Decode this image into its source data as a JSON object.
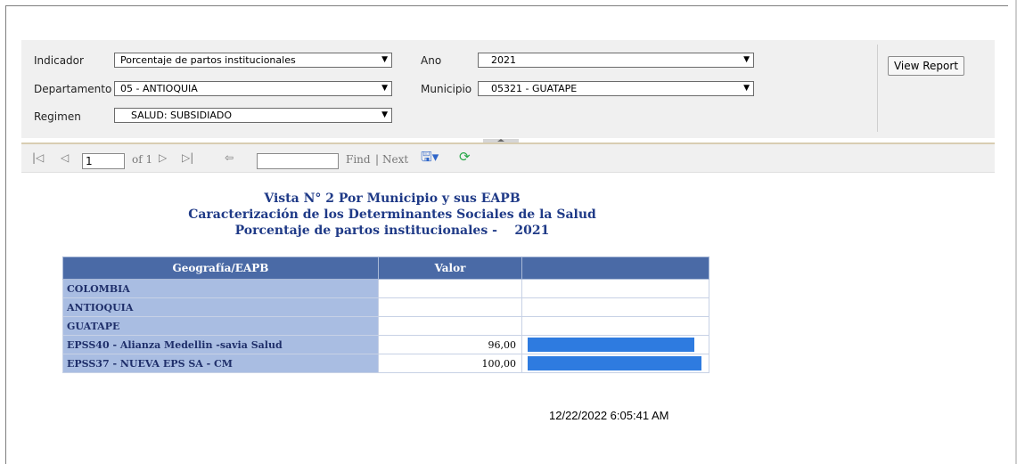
{
  "params": {
    "indicador_label": "Indicador",
    "indicador_value": "Porcentaje de partos institucionales",
    "departamento_label": "Departamento",
    "departamento_value": "05 - ANTIOQUIA",
    "regimen_label": "Regimen",
    "regimen_value": "SALUD: SUBSIDIADO",
    "ano_label": "Ano",
    "ano_value": "2021",
    "municipio_label": "Municipio",
    "municipio_value": "05321 - GUATAPE",
    "view_report_label": "View Report"
  },
  "toolbar": {
    "page_value": "1",
    "of_pages": "of 1",
    "find_label": "Find",
    "separator": "|",
    "next_label": "Next",
    "find_value": ""
  },
  "report": {
    "title_line1": "Vista N° 2 Por Municipio y sus EAPB",
    "title_line2": "Caracterización de los Determinantes Sociales de la Salud",
    "title_line3": "Porcentaje de partos institucionales -    2021",
    "col_geo": "Geografía/EAPB",
    "col_valor": "Valor",
    "rows": [
      {
        "geo": "COLOMBIA",
        "valor": "",
        "bar_pct": 0
      },
      {
        "geo": "ANTIOQUIA",
        "valor": "",
        "bar_pct": 0
      },
      {
        "geo": "GUATAPE",
        "valor": "",
        "bar_pct": 0
      },
      {
        "geo": "EPSS40 - Alianza Medellin -savia Salud",
        "valor": "96,00",
        "bar_pct": 96
      },
      {
        "geo": "EPSS37 - NUEVA EPS SA - CM",
        "valor": "100,00",
        "bar_pct": 100
      }
    ],
    "timestamp": "12/22/2022 6:05:41 AM"
  },
  "colors": {
    "header_bg": "#4a6aa6",
    "geo_bg": "#a9bde2",
    "bar": "#2e7be0",
    "title": "#1f3a87"
  },
  "icons": [
    "first-page-icon",
    "prev-page-icon",
    "next-page-icon",
    "last-page-icon",
    "back-icon",
    "export-icon",
    "refresh-icon"
  ]
}
